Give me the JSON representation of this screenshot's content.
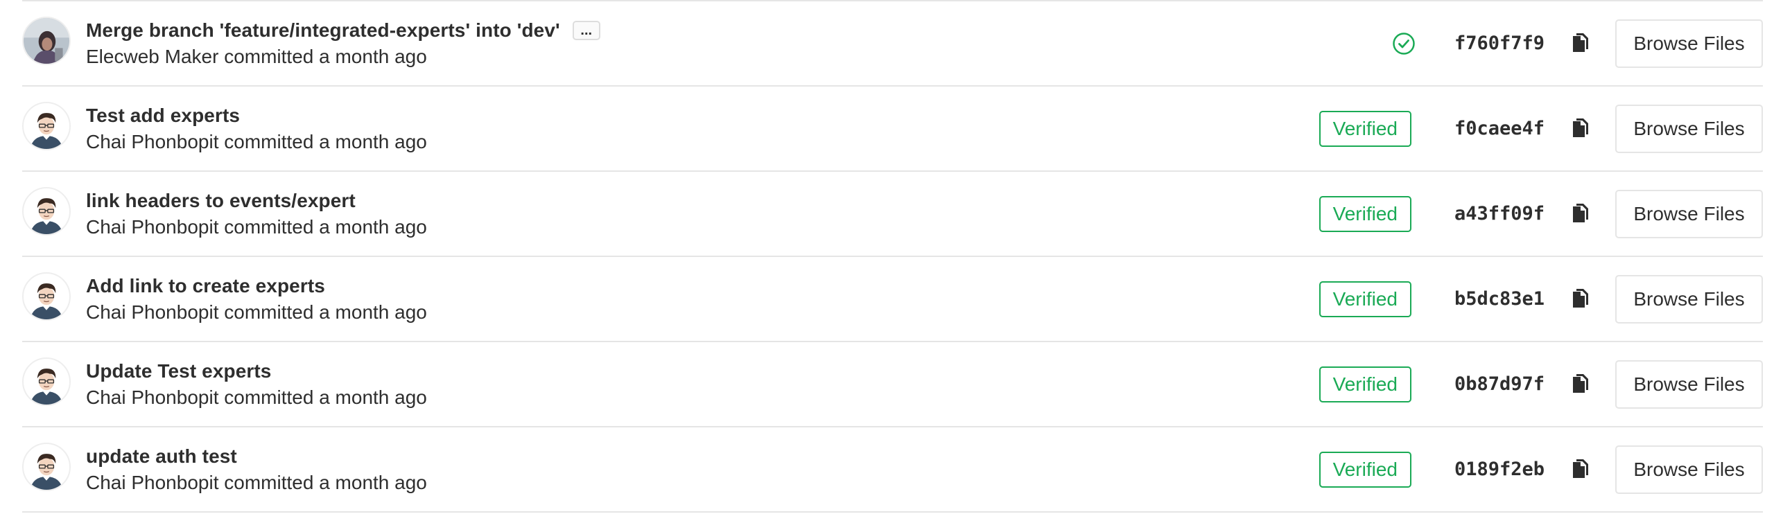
{
  "commits": [
    {
      "title": "Merge branch 'feature/integrated-experts' into 'dev'",
      "has_ellipsis": true,
      "ellipsis_label": "...",
      "author": "Elecweb Maker",
      "committed_text": "committed",
      "time": "a month ago",
      "status": "pipeline-success",
      "sha": "f760f7f9",
      "browse_label": "Browse Files",
      "avatar": "photo-avatar-icon"
    },
    {
      "title": "Test add experts",
      "has_ellipsis": false,
      "author": "Chai Phonbopit",
      "committed_text": "committed",
      "time": "a month ago",
      "status": "verified",
      "badge_label": "Verified",
      "sha": "f0caee4f",
      "browse_label": "Browse Files",
      "avatar": "cartoon-avatar-icon"
    },
    {
      "title": "link headers to events/expert",
      "has_ellipsis": false,
      "author": "Chai Phonbopit",
      "committed_text": "committed",
      "time": "a month ago",
      "status": "verified",
      "badge_label": "Verified",
      "sha": "a43ff09f",
      "browse_label": "Browse Files",
      "avatar": "cartoon-avatar-icon"
    },
    {
      "title": "Add link to create experts",
      "has_ellipsis": false,
      "author": "Chai Phonbopit",
      "committed_text": "committed",
      "time": "a month ago",
      "status": "verified",
      "badge_label": "Verified",
      "sha": "b5dc83e1",
      "browse_label": "Browse Files",
      "avatar": "cartoon-avatar-icon"
    },
    {
      "title": "Update Test experts",
      "has_ellipsis": false,
      "author": "Chai Phonbopit",
      "committed_text": "committed",
      "time": "a month ago",
      "status": "verified",
      "badge_label": "Verified",
      "sha": "0b87d97f",
      "browse_label": "Browse Files",
      "avatar": "cartoon-avatar-icon"
    },
    {
      "title": "update auth test",
      "has_ellipsis": false,
      "author": "Chai Phonbopit",
      "committed_text": "committed",
      "time": "a month ago",
      "status": "verified",
      "badge_label": "Verified",
      "sha": "0189f2eb",
      "browse_label": "Browse Files",
      "avatar": "cartoon-avatar-icon"
    }
  ],
  "colors": {
    "verified_green": "#1aaa55",
    "text": "#2e2e2e",
    "border": "#e5e5e5"
  },
  "icons": {
    "copy": "clipboard-copy-icon",
    "pipeline_success": "check-circle-icon"
  }
}
